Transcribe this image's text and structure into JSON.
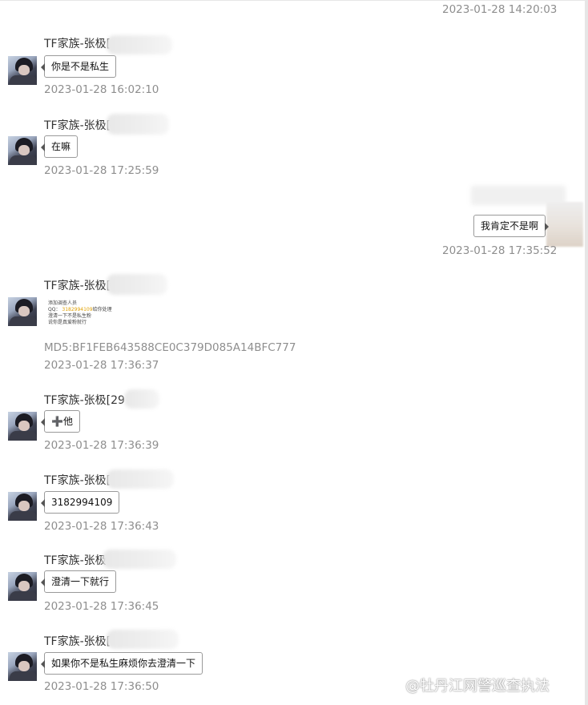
{
  "top_timestamp": "2023-01-28 14:20:03",
  "messages": [
    {
      "sender": "TF家族-张极[",
      "text": "你是不是私生",
      "time": "2023-01-28 16:02:10"
    },
    {
      "sender": "TF家族-张极[",
      "text": "在嘛",
      "time": "2023-01-28 17:25:59"
    },
    {
      "text": "我肯定不是啊",
      "time": "2023-01-28 17:35:52"
    },
    {
      "sender": "TF家族-张极[",
      "image_lines": [
        "添加调查人员",
        "QQ：",
        "3182994109",
        "给你处理",
        "澄清一下不是私生粉",
        "说你是真爱粉就行"
      ],
      "md5": "MD5:BF1FEB643588CE0C379D085A14BFC777",
      "time": "2023-01-28 17:36:37"
    },
    {
      "sender": "TF家族-张极[29",
      "text": "➕他",
      "time": "2023-01-28 17:36:39"
    },
    {
      "sender": "TF家族-张极[",
      "text": "3182994109",
      "time": "2023-01-28 17:36:43"
    },
    {
      "sender": "TF家族-张极",
      "text": "澄清一下就行",
      "time": "2023-01-28 17:36:45"
    },
    {
      "sender": "TF家族-张极[",
      "text": "如果你不是私生麻烦你去澄清一下",
      "time": "2023-01-28 17:36:50"
    }
  ],
  "watermark": "@牡丹江网警巡查执法",
  "icons": {
    "avatar": "user-avatar-photo",
    "watermark": "weibo-logo-icon"
  }
}
